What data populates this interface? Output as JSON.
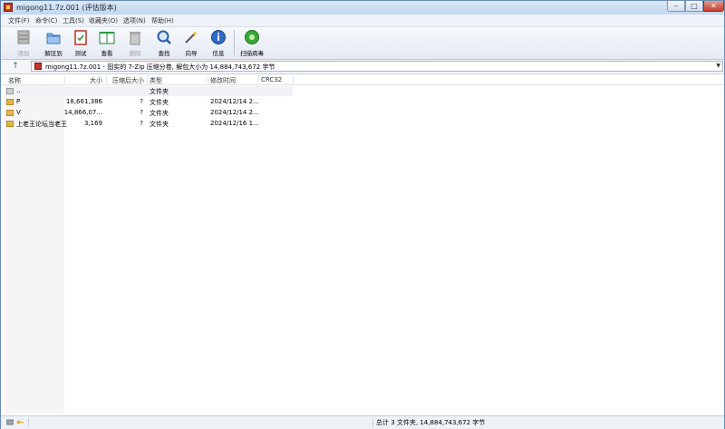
{
  "window": {
    "title": "migong11.7z.001 (评估版本)"
  },
  "menu": [
    "文件(F)",
    "命令(C)",
    "工具(S)",
    "收藏夹(O)",
    "选项(N)",
    "帮助(H)"
  ],
  "toolbar": {
    "buttons": [
      {
        "label": "添加",
        "icon": "add-archive-icon",
        "enabled": false
      },
      {
        "label": "解压到",
        "icon": "extract-folder-icon",
        "enabled": true
      },
      {
        "label": "测试",
        "icon": "test-clipboard-icon",
        "enabled": true
      },
      {
        "label": "查看",
        "icon": "view-book-icon",
        "enabled": true
      },
      {
        "label": "删除",
        "icon": "trash-icon",
        "enabled": false
      },
      {
        "label": "查找",
        "icon": "magnifier-icon",
        "enabled": true
      },
      {
        "label": "向导",
        "icon": "wizard-wand-icon",
        "enabled": true
      },
      {
        "label": "信息",
        "icon": "info-icon",
        "enabled": true
      },
      {
        "label": "扫描病毒",
        "icon": "virus-scan-icon",
        "enabled": true
      }
    ]
  },
  "address": {
    "up_label": "↑",
    "text": "migong11.7z.001 - 固实的 7-Zip 压缩分卷, 解包大小为 14,884,743,672 字节"
  },
  "columns": [
    "名称",
    "大小",
    "压缩后大小",
    "类型",
    "修改时间",
    "CRC32"
  ],
  "rows": [
    {
      "name": "..",
      "size": "",
      "packed": "",
      "type": "文件夹",
      "modified": "",
      "crc": ""
    },
    {
      "name": "P",
      "size": "18,661,386",
      "packed": "?",
      "type": "文件夹",
      "modified": "2024/12/14 2...",
      "crc": ""
    },
    {
      "name": "V",
      "size": "14,866,07...",
      "packed": "?",
      "type": "文件夹",
      "modified": "2024/12/14 2...",
      "crc": ""
    },
    {
      "name": "上老王论坛当老王",
      "size": "3,169",
      "packed": "?",
      "type": "文件夹",
      "modified": "2024/12/16 1...",
      "crc": ""
    }
  ],
  "status": {
    "summary": "总计 3 文件夹, 14,884,743,672 字节"
  },
  "colors": {
    "titlebar": "#c3d6ee",
    "folder": "#e3b64a",
    "close": "#c0402b"
  }
}
